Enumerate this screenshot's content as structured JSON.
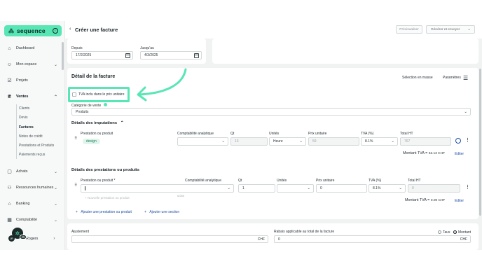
{
  "brand": {
    "name": "sequence",
    "accent": "#58e6b4"
  },
  "header": {
    "back_icon": "chevron-left-icon",
    "title": "Créer une facture",
    "preview_label": "Prévisualiser",
    "generate_label": "Générer et envoyer"
  },
  "sidebar": {
    "items": [
      {
        "label": "Dashboard",
        "icon": "home-icon"
      },
      {
        "label": "Mon espace",
        "icon": "user-icon"
      },
      {
        "label": "Projets",
        "icon": "check-square-icon"
      },
      {
        "label": "Ventes",
        "icon": "money-bag-icon"
      },
      {
        "label": "Achats",
        "icon": "shopping-bag-icon"
      },
      {
        "label": "Ressources humaines",
        "icon": "users-icon"
      },
      {
        "label": "Banking",
        "icon": "bank-icon"
      },
      {
        "label": "Comptabilité",
        "icon": "calculator-icon"
      }
    ],
    "ventes_sub": [
      "Clients",
      "Devis",
      "Factures",
      "Notes de crédit",
      "Prestations et Produits",
      "Paiements reçus"
    ],
    "user_name": "Rogers",
    "user_initials": "JR",
    "help_badge": "25"
  },
  "dates": {
    "from_label": "Depuis",
    "from_value": "17/2/2025",
    "to_label": "Jusqu'au",
    "to_value": "4/3/2025"
  },
  "detail": {
    "title": "Détail de la facture",
    "bulk_select": "Sélection en masse",
    "settings": "Paramètres",
    "vat_included_label": "TVA inclu dans le prix unitaire",
    "category_label": "Catégorie de vente",
    "category_value": "Produits"
  },
  "imputations": {
    "title": "Détails des imputations",
    "columns": [
      "Prestation ou produit",
      "Comptabilité analytique",
      "Qt",
      "Unités",
      "Prix unitaire",
      "TVA (%)",
      "Total HT"
    ],
    "row": {
      "product": "design",
      "qty": "13",
      "unit": "Heure",
      "price": "59",
      "vat": "8.1%",
      "total": "767"
    },
    "vat_amount_label": "Montant TVA =",
    "vat_amount_value": "62.13 CHF",
    "edit": "Editer"
  },
  "products": {
    "title": "Détails des prestations ou produits",
    "columns": [
      "Prestation ou produit *",
      "Comptabilité analytique",
      "Qt",
      "Unités",
      "Prix unitaire",
      "TVA (%)",
      "Total HT"
    ],
    "row": {
      "product": "",
      "qty": "1",
      "unit": "",
      "price": "0",
      "vat": "8.1%",
      "total": "0"
    },
    "new_item_hint": "+ Nouvelle prestation ou produit",
    "char_count": "0/250",
    "vat_amount_label": "Montant TVA =",
    "vat_amount_value": "0.00 CHF",
    "edit": "Editer",
    "add_item": "Ajouter une prestation ou produit",
    "add_section": "Ajouter une section"
  },
  "footer": {
    "adjustment_label": "Ajustement",
    "adjustment_currency": "CHF",
    "discount_label": "Rabais applicable au total de la facture",
    "discount_value": "0",
    "discount_currency": "CHF",
    "rate_label": "Taux",
    "amount_label": "Montant"
  }
}
